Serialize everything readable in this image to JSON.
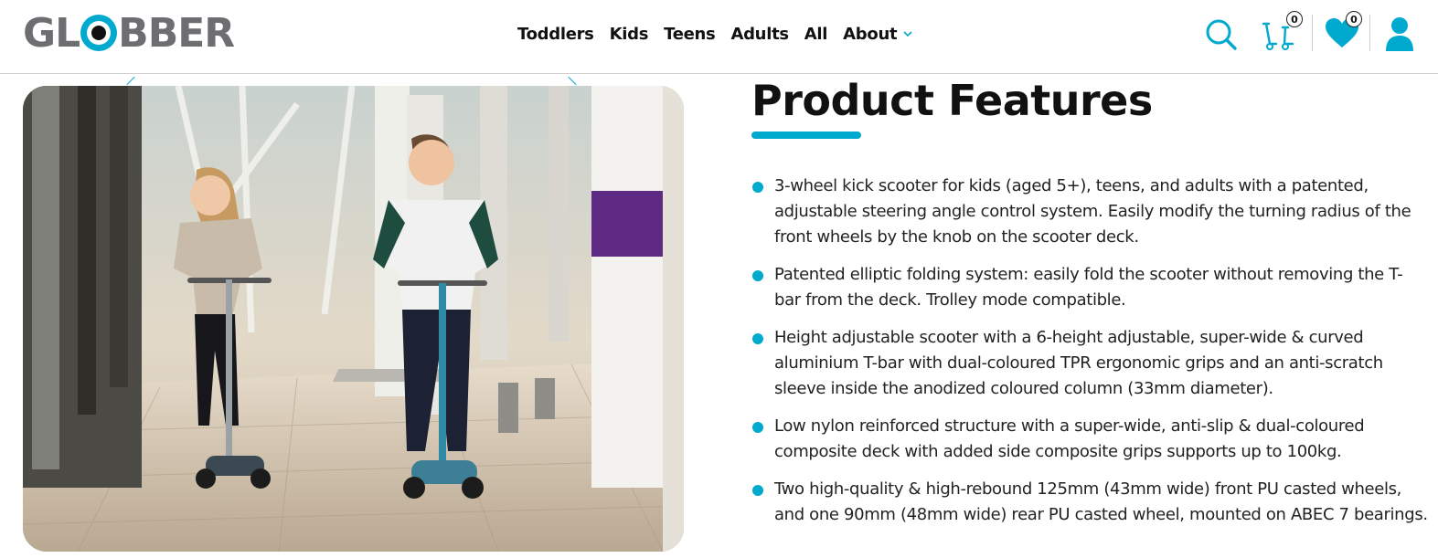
{
  "brand": {
    "logo_text_left": "GL",
    "logo_text_right": "BBER",
    "accent_color": "#00a9ce"
  },
  "nav": {
    "items": [
      {
        "label": "Toddlers"
      },
      {
        "label": "Kids"
      },
      {
        "label": "Teens"
      },
      {
        "label": "Adults"
      },
      {
        "label": "All"
      },
      {
        "label": "About"
      }
    ]
  },
  "header_icons": {
    "search": "search-icon",
    "compare": "scooter-compare-icon",
    "compare_count": "0",
    "wishlist": "heart-icon",
    "wishlist_count": "0",
    "account": "user-icon"
  },
  "features": {
    "title": "Product Features",
    "items": [
      "3-wheel kick scooter for kids (aged 5+), teens, and adults with a patented, adjustable steering angle control system. Easily modify the turning radius of the front wheels by the knob on the scooter deck.",
      "Patented elliptic folding system: easily fold the scooter without removing the T-bar from the deck. Trolley mode compatible.",
      "Height adjustable scooter with a 6-height adjustable, super-wide & curved aluminium T-bar with dual-coloured TPR ergonomic grips and an anti-scratch sleeve inside the anodized coloured column (33mm diameter).",
      "Low nylon reinforced structure with a super-wide, anti-slip & dual-coloured composite deck with added side composite grips supports up to 100kg.",
      "Two high-quality & high-rebound 125mm (43mm wide) front PU casted wheels, and one 90mm (48mm wide) rear PU casted wheel, mounted on ABEC 7 bearings."
    ]
  }
}
